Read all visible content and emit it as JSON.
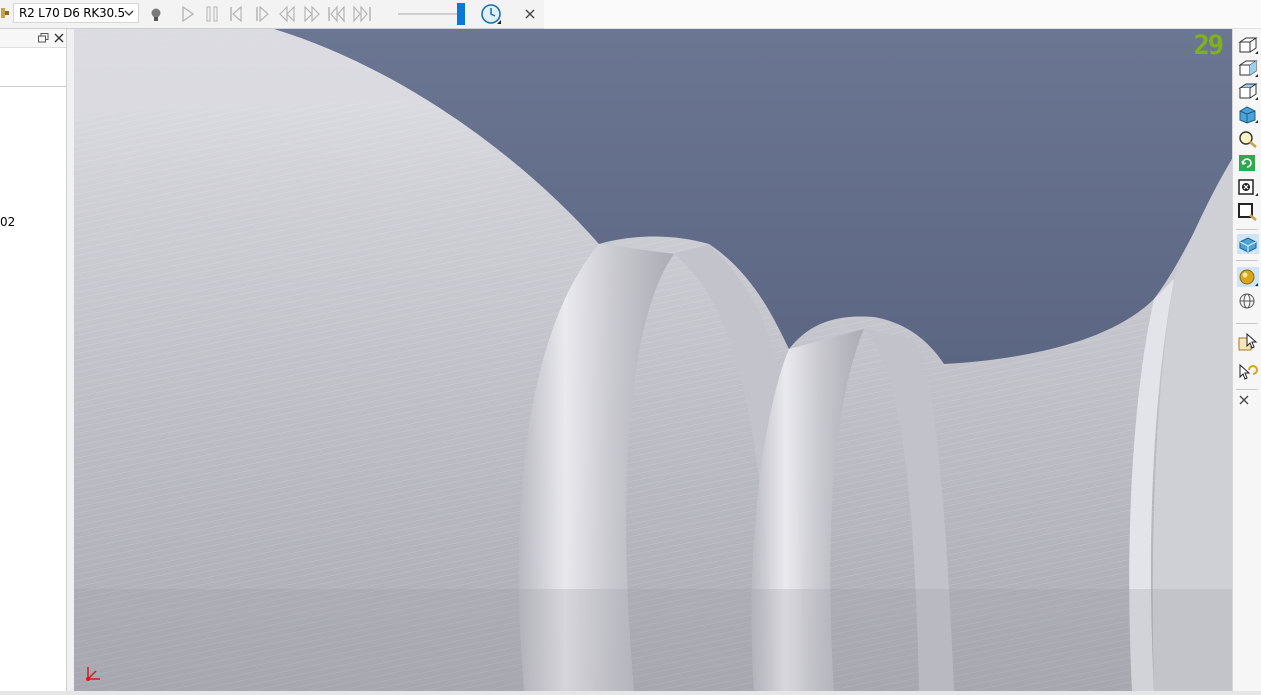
{
  "toolbar": {
    "tool_select": {
      "value": "R2 L70 D6 RK30.5",
      "icon": "chevron-down-icon"
    },
    "buttons": [
      {
        "name": "lightbulb-icon"
      },
      {
        "name": "play-icon"
      },
      {
        "name": "pause-icon"
      },
      {
        "name": "step-back-icon"
      },
      {
        "name": "step-forward-icon"
      },
      {
        "name": "rewind-icon"
      },
      {
        "name": "fast-forward-icon"
      },
      {
        "name": "skip-to-start-icon"
      },
      {
        "name": "skip-to-end-icon"
      }
    ],
    "speed_slider": {
      "value": 0.92
    },
    "clock_icon": "clock-icon",
    "close_icon": "close-icon"
  },
  "left_panel": {
    "visible_text": "02"
  },
  "viewport": {
    "fps_counter": "29",
    "fps_color": "#7fb21a",
    "background_color": "#5d6883",
    "model_color": "#c9cacf"
  },
  "right_toolbar": {
    "buttons": [
      {
        "name": "view-front-icon"
      },
      {
        "name": "view-side-icon"
      },
      {
        "name": "view-top-icon"
      },
      {
        "name": "view-iso-icon"
      },
      {
        "name": "zoom-icon"
      },
      {
        "name": "refresh-icon"
      },
      {
        "name": "fit-all-icon"
      },
      {
        "name": "zoom-window-icon"
      },
      {
        "name": "shaded-view-icon"
      },
      {
        "name": "sphere-render-icon"
      },
      {
        "name": "wireframe-globe-icon"
      },
      {
        "name": "select-cursor-icon"
      },
      {
        "name": "undo-select-icon"
      },
      {
        "name": "close-icon"
      }
    ]
  },
  "colors": {
    "accent": "#0a78d7",
    "toolbar_bg": "#f3f3f3"
  }
}
